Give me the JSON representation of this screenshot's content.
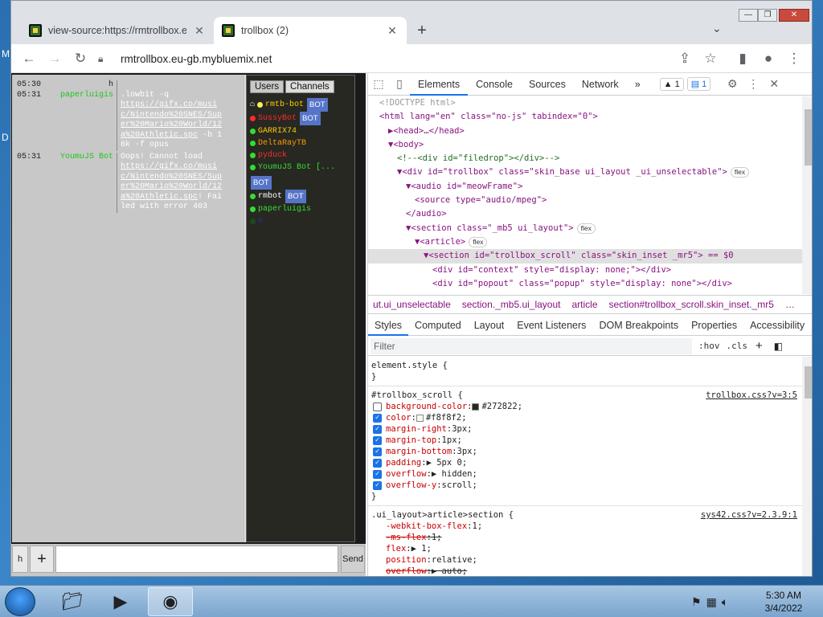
{
  "desktop": {
    "left_m": "M",
    "left_d": "D"
  },
  "browser": {
    "tabs": [
      {
        "title": "view-source:https://rmtrollbox.eu-",
        "close": "✕"
      },
      {
        "title": "trollbox (2)",
        "close": "✕"
      }
    ],
    "new_tab": "+",
    "tab_menu": "⌄",
    "window_controls": {
      "minimize": "—",
      "maximize": "❐",
      "close": "✕"
    },
    "toolbar": {
      "back": "←",
      "forward": "→",
      "reload": "↻",
      "url": "rmtrollbox.eu-gb.mybluemix.net",
      "share": "⇪",
      "star": "☆",
      "sidebar": "▮",
      "profile": "●",
      "menu": "⋮"
    }
  },
  "trollbox": {
    "messages": [
      {
        "time": "05:30",
        "nick": "h",
        "nick_color": "#222222",
        "text": ""
      },
      {
        "time": "05:31",
        "nick": "paperluigis",
        "nick_color": "#1ec51e",
        "text": ".lowbit -q",
        "link": "https://gifx.co/music/Nintendo%20SNES/Super%20Mario%20World/12a%20Athletic.spc",
        "after": "-b 16k -f opus"
      },
      {
        "time": "05:31",
        "nick": "YoumuJS Bot",
        "nick_color": "#1ec51e",
        "text": "Oops! Cannot load",
        "link": "https://gifx.co/music/Nintendo%20SNES/Super%20Mario%20World/12a%20Athletic.spc",
        "after": "! Failed with error 403"
      }
    ],
    "user_tabs": [
      "Users",
      "Channels"
    ],
    "users": [
      {
        "name": "rmtb-bot",
        "color": "#ffcc00",
        "bot": true,
        "prefix": "⌂"
      },
      {
        "name": "SussyBot",
        "color": "#ff2a2a",
        "bot": true
      },
      {
        "name": "GARRIX74",
        "color": "#ffcc00",
        "bot": false
      },
      {
        "name": "DeltaRayTB",
        "color": "#ff9900",
        "bot": false
      },
      {
        "name": "pyduck",
        "color": "#ff2a2a",
        "bot": false
      },
      {
        "name": "YoumuJS Bot [...",
        "color": "#33dd33",
        "bot": true
      },
      {
        "name": "rmbot",
        "color": "#ffffff",
        "bot": true
      },
      {
        "name": "paperluigis",
        "color": "#33dd33",
        "bot": false
      },
      {
        "name": "n",
        "color": "#2233aa",
        "bot": false
      }
    ],
    "input": {
      "h_label": "h",
      "plus_label": "+",
      "send_label": "Send",
      "value": ""
    },
    "bot_label": "BOT"
  },
  "devtools": {
    "tabs": [
      "Elements",
      "Console",
      "Sources",
      "Network"
    ],
    "more": "»",
    "warnings": "1",
    "messages": "1",
    "elements": [
      {
        "indent": 0,
        "html": "<!DOCTYPE html>",
        "type": "doctype"
      },
      {
        "indent": 0,
        "html": "<html lang=\"en\" class=\"no-js\" tabindex=\"0\">"
      },
      {
        "indent": 1,
        "html": "▶<head>…</head>"
      },
      {
        "indent": 1,
        "html": "▼<body>"
      },
      {
        "indent": 2,
        "html": "<!--<div id=\"filedrop\"></div>-->",
        "type": "comment"
      },
      {
        "indent": 2,
        "html": "▼<div id=\"trollbox\" class=\"skin_base ui_layout _ui_unselectable\">",
        "pill": "flex"
      },
      {
        "indent": 3,
        "html": "▼<audio id=\"meowFrame\">"
      },
      {
        "indent": 4,
        "html": "<source type=\"audio/mpeg\">"
      },
      {
        "indent": 3,
        "html": "</audio>"
      },
      {
        "indent": 3,
        "html": "▼<section class=\"_mb5 ui_layout\">",
        "pill": "flex"
      },
      {
        "indent": 4,
        "html": "▼<article>",
        "pill": "flex"
      },
      {
        "indent": 5,
        "html": "▼<section id=\"trollbox_scroll\" class=\"skin_inset _mr5\"> == $0",
        "selected": true
      },
      {
        "indent": 6,
        "html": "<div id=\"context\" style=\"display: none;\"></div>"
      },
      {
        "indent": 6,
        "html": "<div id=\"popout\" class=\"popup\" style=\"display: none\"></div>"
      }
    ],
    "breadcrumbs": [
      "ut.ui_unselectable",
      "section._mb5.ui_layout",
      "article",
      "section#trollbox_scroll.skin_inset._mr5",
      "…"
    ],
    "style_tabs": [
      "Styles",
      "Computed",
      "Layout",
      "Event Listeners",
      "DOM Breakpoints",
      "Properties",
      "Accessibility"
    ],
    "filter_placeholder": "Filter",
    "hov": ":hov",
    "cls": ".cls",
    "rules": [
      {
        "selector": "element.style {",
        "source": "",
        "decls": []
      },
      {
        "selector": "#trollbox_scroll {",
        "source": "trollbox.css?v=3:5",
        "decls": [
          {
            "prop": "background-color",
            "val": "#272822",
            "on": false,
            "swatch": "#272822"
          },
          {
            "prop": "color",
            "val": "#f8f8f2",
            "on": true,
            "swatch": "#f8f8f2"
          },
          {
            "prop": "margin-right",
            "val": "3px",
            "on": true
          },
          {
            "prop": "margin-top",
            "val": "1px",
            "on": true
          },
          {
            "prop": "margin-bottom",
            "val": "3px",
            "on": true
          },
          {
            "prop": "padding",
            "val": "▶ 5px 0",
            "on": true
          },
          {
            "prop": "overflow",
            "val": "▶ hidden",
            "on": true
          },
          {
            "prop": "overflow-y",
            "val": "scroll",
            "on": true
          }
        ]
      },
      {
        "selector": ".ui_layout>article>section {",
        "source": "sys42.css?v=2.3.9:1",
        "decls": [
          {
            "prop": "-webkit-box-flex",
            "val": "1",
            "on": null
          },
          {
            "prop": "-ms-flex",
            "val": "1",
            "on": null,
            "strike": true
          },
          {
            "prop": "flex",
            "val": "▶ 1",
            "on": null
          },
          {
            "prop": "position",
            "val": "relative",
            "on": null
          },
          {
            "prop": "overflow",
            "val": "▶ auto",
            "on": null,
            "strike": true
          }
        ]
      }
    ]
  },
  "taskbar": {
    "apps": [
      "folder-icon",
      "media-player-icon",
      "chrome-icon"
    ],
    "time": "5:30 AM",
    "date": "3/4/2022"
  }
}
